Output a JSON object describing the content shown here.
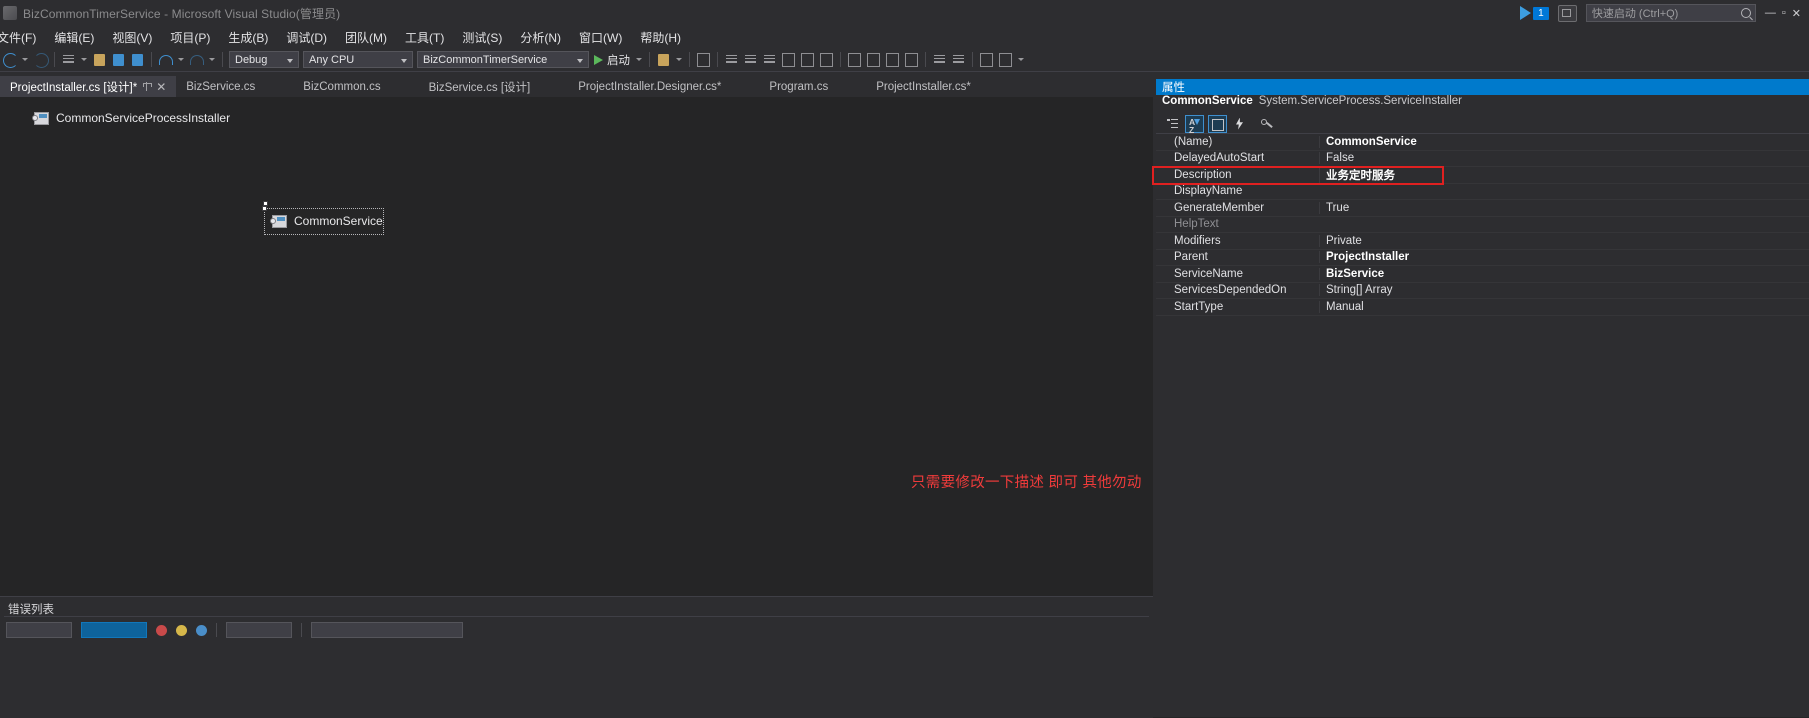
{
  "window": {
    "title": "BizCommonTimerService - Microsoft Visual Studio(管理员)",
    "minimize": "—",
    "maximize": "▫",
    "close": "✕",
    "notification_count": "1"
  },
  "menu": {
    "items": [
      {
        "label": "文件(F)"
      },
      {
        "label": "编辑(E)"
      },
      {
        "label": "视图(V)"
      },
      {
        "label": "项目(P)"
      },
      {
        "label": "生成(B)"
      },
      {
        "label": "调试(D)"
      },
      {
        "label": "团队(M)"
      },
      {
        "label": "工具(T)"
      },
      {
        "label": "测试(S)"
      },
      {
        "label": "分析(N)"
      },
      {
        "label": "窗口(W)"
      },
      {
        "label": "帮助(H)"
      }
    ]
  },
  "quick_launch": {
    "placeholder": "快速启动 (Ctrl+Q)"
  },
  "toolbar": {
    "configuration": "Debug",
    "platform": "Any CPU",
    "startup_project": "BizCommonTimerService",
    "run_label": "启动"
  },
  "tabs": [
    {
      "label": "ProjectInstaller.cs [设计]*",
      "active": true,
      "close": "✕"
    },
    {
      "label": "BizService.cs",
      "active": false
    },
    {
      "label": "BizCommon.cs",
      "active": false
    },
    {
      "label": "BizService.cs [设计]",
      "active": false
    },
    {
      "label": "ProjectInstaller.Designer.cs*",
      "active": false
    },
    {
      "label": "Program.cs",
      "active": false
    },
    {
      "label": "ProjectInstaller.cs*",
      "active": false
    }
  ],
  "designer": {
    "components": [
      {
        "label": "CommonServiceProcessInstaller"
      },
      {
        "label": "CommonService"
      }
    ],
    "annotation": "只需要修改一下描述 即可 其他勿动"
  },
  "error_list": {
    "title": "错误列表"
  },
  "properties": {
    "panel_title": "属性",
    "object_name": "CommonService",
    "object_type": "System.ServiceProcess.ServiceInstaller",
    "toolbar": {
      "categorized": "categorized-icon",
      "alphabetical": "alphabetical-sort-icon",
      "properties": "properties-page-icon",
      "events": "events-bolt-icon",
      "property_pages": "property-pages-wrench-icon"
    },
    "highlight_color": "#e02020",
    "rows": [
      {
        "name": "(Name)",
        "value": "CommonService",
        "bold": true,
        "dim": false,
        "highlight": false
      },
      {
        "name": "DelayedAutoStart",
        "value": "False",
        "bold": false,
        "dim": false,
        "highlight": false
      },
      {
        "name": "Description",
        "value": "业务定时服务",
        "bold": true,
        "dim": false,
        "highlight": true
      },
      {
        "name": "DisplayName",
        "value": "",
        "bold": false,
        "dim": false,
        "highlight": false
      },
      {
        "name": "GenerateMember",
        "value": "True",
        "bold": false,
        "dim": false,
        "highlight": false
      },
      {
        "name": "HelpText",
        "value": "",
        "bold": false,
        "dim": true,
        "highlight": false
      },
      {
        "name": "Modifiers",
        "value": "Private",
        "bold": false,
        "dim": false,
        "highlight": false
      },
      {
        "name": "Parent",
        "value": "ProjectInstaller",
        "bold": true,
        "dim": false,
        "highlight": false
      },
      {
        "name": "ServiceName",
        "value": "BizService",
        "bold": true,
        "dim": false,
        "highlight": false
      },
      {
        "name": "ServicesDependedOn",
        "value": "String[] Array",
        "bold": false,
        "dim": false,
        "highlight": false
      },
      {
        "name": "StartType",
        "value": "Manual",
        "bold": false,
        "dim": false,
        "highlight": false
      }
    ]
  }
}
